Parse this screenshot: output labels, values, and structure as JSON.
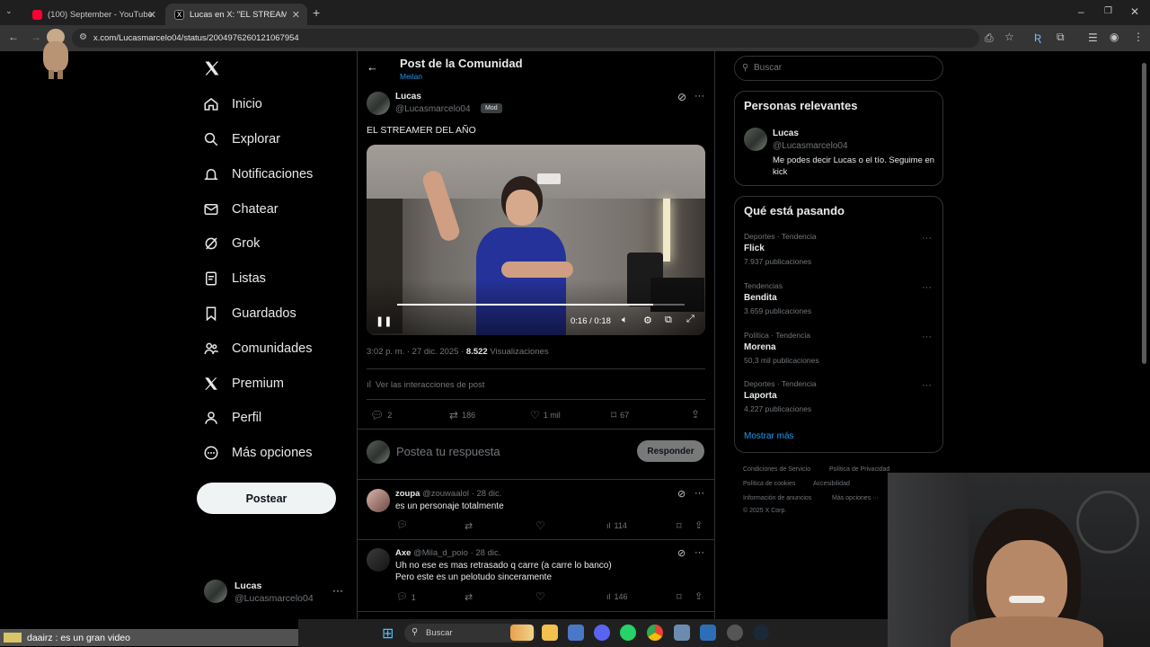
{
  "browser": {
    "tabs": [
      {
        "title": "(100) September - YouTube"
      },
      {
        "title": "Lucas en X: \"EL STREAMER"
      }
    ],
    "url": "x.com/Lucasmarcelo04/status/2004976260121067954"
  },
  "sidebar": {
    "items": [
      {
        "label": "Inicio",
        "icon": "home-icon"
      },
      {
        "label": "Explorar",
        "icon": "search-icon"
      },
      {
        "label": "Notificaciones",
        "icon": "bell-icon"
      },
      {
        "label": "Chatear",
        "icon": "mail-icon"
      },
      {
        "label": "Grok",
        "icon": "grok-icon"
      },
      {
        "label": "Listas",
        "icon": "list-icon"
      },
      {
        "label": "Guardados",
        "icon": "bookmark-icon"
      },
      {
        "label": "Comunidades",
        "icon": "people-icon"
      },
      {
        "label": "Premium",
        "icon": "x-logo-icon"
      },
      {
        "label": "Perfil",
        "icon": "person-icon"
      },
      {
        "label": "Más opciones",
        "icon": "more-circle-icon"
      }
    ],
    "post_button": "Postear",
    "account": {
      "name": "Lucas",
      "handle": "@Lucasmarcelo04"
    }
  },
  "header": {
    "title": "Post de la Comunidad",
    "community": "Meilan"
  },
  "post": {
    "author_name": "Lucas",
    "author_handle": "@Lucasmarcelo04",
    "badge": "Mod",
    "text": "EL STREAMER DEL AÑO",
    "video_time": "0:16 / 0:18",
    "video_progress": 0.89,
    "timestamp": "3:02 p. m. · 27 dic. 2025 ·",
    "views_count": "8.522",
    "views_label": "Visualizaciones",
    "interactions": "Ver las interacciones de post",
    "replies": "2",
    "reposts": "186",
    "likes": "1 mil",
    "bookmarks": "67"
  },
  "reply_box": {
    "placeholder": "Postea tu respuesta",
    "button": "Responder"
  },
  "replies": [
    {
      "name": "zoupa",
      "handle": "@zouwaalol",
      "date": "· 28 dic.",
      "text1": "es un personaje totalmente",
      "text2": "",
      "replies": "",
      "views": "114"
    },
    {
      "name": "Axe",
      "handle": "@Mila_d_poio",
      "date": "· 28 dic.",
      "text1": "Uh no ese es mas retrasado q carre (a carre lo banco)",
      "text2": "Pero este es un pelotudo sinceramente",
      "replies": "1",
      "views": "146"
    }
  ],
  "search": {
    "placeholder": "Buscar"
  },
  "relevant": {
    "title": "Personas relevantes",
    "name": "Lucas",
    "handle": "@Lucasmarcelo04",
    "bio": "Me podes decir Lucas o el tío. Seguime en kick"
  },
  "trends": {
    "title": "Qué está pasando",
    "items": [
      {
        "category": "Deportes · Tendencia",
        "name": "Flick",
        "count": "7.937 publicaciones"
      },
      {
        "category": "Tendencias",
        "name": "Bendita",
        "count": "3.659 publicaciones"
      },
      {
        "category": "Política · Tendencia",
        "name": "Morena",
        "count": "50,3 mil publicaciones"
      },
      {
        "category": "Deportes · Tendencia",
        "name": "Laporta",
        "count": "4.227 publicaciones"
      }
    ],
    "show_more": "Mostrar más"
  },
  "footer": {
    "terms": "Condiciones de Servicio",
    "privacy": "Política de Privacidad",
    "cookies": "Política de cookies",
    "accessibility": "Accesibilidad",
    "ads": "Información de anuncios",
    "more": "Más opciones ···",
    "copyright": "© 2025 X Corp."
  },
  "overlay": {
    "chat_message": "daairz : es un gran video"
  },
  "taskbar": {
    "search_placeholder": "Buscar"
  },
  "colors": {
    "accent": "#1d9bf0",
    "background": "#000000",
    "border": "#2f3336"
  }
}
